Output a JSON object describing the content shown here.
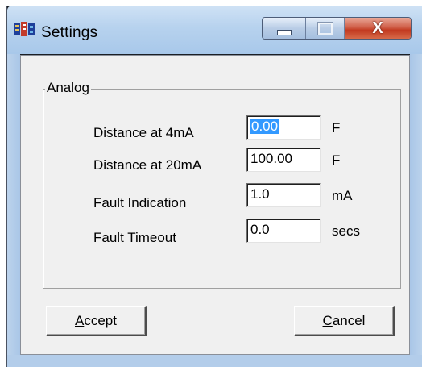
{
  "window": {
    "title": "Settings",
    "icon": "app-icon",
    "caption_buttons": {
      "minimize_icon": "minimize-icon",
      "maximize_icon": "maximize-icon",
      "close_glyph": "X"
    }
  },
  "group": {
    "label": "Analog"
  },
  "fields": [
    {
      "label": "Distance at  4mA",
      "value": "0.00",
      "unit": "F",
      "selected": true
    },
    {
      "label": "Distance at 20mA",
      "value": "100.00",
      "unit": "F",
      "selected": false
    },
    {
      "label": "Fault Indication",
      "value": "1.0",
      "unit": "mA",
      "selected": false
    },
    {
      "label": "Fault Timeout",
      "value": "0.0",
      "unit": "secs",
      "selected": false
    }
  ],
  "buttons": {
    "accept": {
      "mnemonic": "A",
      "rest": "ccept"
    },
    "cancel": {
      "mnemonic": "C",
      "rest": "ancel"
    }
  },
  "colors": {
    "selection": "#3399ff",
    "close_button": "#c2391f"
  }
}
